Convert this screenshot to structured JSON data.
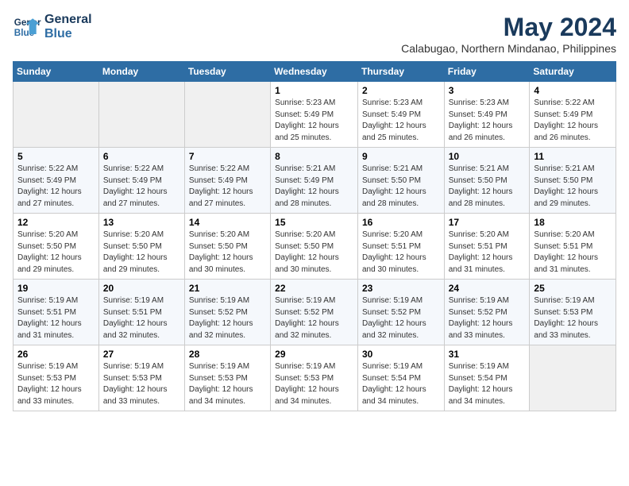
{
  "logo": {
    "line1": "General",
    "line2": "Blue"
  },
  "title": "May 2024",
  "subtitle": "Calabugao, Northern Mindanao, Philippines",
  "days_of_week": [
    "Sunday",
    "Monday",
    "Tuesday",
    "Wednesday",
    "Thursday",
    "Friday",
    "Saturday"
  ],
  "weeks": [
    [
      {
        "day": "",
        "info": ""
      },
      {
        "day": "",
        "info": ""
      },
      {
        "day": "",
        "info": ""
      },
      {
        "day": "1",
        "info": "Sunrise: 5:23 AM\nSunset: 5:49 PM\nDaylight: 12 hours\nand 25 minutes."
      },
      {
        "day": "2",
        "info": "Sunrise: 5:23 AM\nSunset: 5:49 PM\nDaylight: 12 hours\nand 25 minutes."
      },
      {
        "day": "3",
        "info": "Sunrise: 5:23 AM\nSunset: 5:49 PM\nDaylight: 12 hours\nand 26 minutes."
      },
      {
        "day": "4",
        "info": "Sunrise: 5:22 AM\nSunset: 5:49 PM\nDaylight: 12 hours\nand 26 minutes."
      }
    ],
    [
      {
        "day": "5",
        "info": "Sunrise: 5:22 AM\nSunset: 5:49 PM\nDaylight: 12 hours\nand 27 minutes."
      },
      {
        "day": "6",
        "info": "Sunrise: 5:22 AM\nSunset: 5:49 PM\nDaylight: 12 hours\nand 27 minutes."
      },
      {
        "day": "7",
        "info": "Sunrise: 5:22 AM\nSunset: 5:49 PM\nDaylight: 12 hours\nand 27 minutes."
      },
      {
        "day": "8",
        "info": "Sunrise: 5:21 AM\nSunset: 5:49 PM\nDaylight: 12 hours\nand 28 minutes."
      },
      {
        "day": "9",
        "info": "Sunrise: 5:21 AM\nSunset: 5:50 PM\nDaylight: 12 hours\nand 28 minutes."
      },
      {
        "day": "10",
        "info": "Sunrise: 5:21 AM\nSunset: 5:50 PM\nDaylight: 12 hours\nand 28 minutes."
      },
      {
        "day": "11",
        "info": "Sunrise: 5:21 AM\nSunset: 5:50 PM\nDaylight: 12 hours\nand 29 minutes."
      }
    ],
    [
      {
        "day": "12",
        "info": "Sunrise: 5:20 AM\nSunset: 5:50 PM\nDaylight: 12 hours\nand 29 minutes."
      },
      {
        "day": "13",
        "info": "Sunrise: 5:20 AM\nSunset: 5:50 PM\nDaylight: 12 hours\nand 29 minutes."
      },
      {
        "day": "14",
        "info": "Sunrise: 5:20 AM\nSunset: 5:50 PM\nDaylight: 12 hours\nand 30 minutes."
      },
      {
        "day": "15",
        "info": "Sunrise: 5:20 AM\nSunset: 5:50 PM\nDaylight: 12 hours\nand 30 minutes."
      },
      {
        "day": "16",
        "info": "Sunrise: 5:20 AM\nSunset: 5:51 PM\nDaylight: 12 hours\nand 30 minutes."
      },
      {
        "day": "17",
        "info": "Sunrise: 5:20 AM\nSunset: 5:51 PM\nDaylight: 12 hours\nand 31 minutes."
      },
      {
        "day": "18",
        "info": "Sunrise: 5:20 AM\nSunset: 5:51 PM\nDaylight: 12 hours\nand 31 minutes."
      }
    ],
    [
      {
        "day": "19",
        "info": "Sunrise: 5:19 AM\nSunset: 5:51 PM\nDaylight: 12 hours\nand 31 minutes."
      },
      {
        "day": "20",
        "info": "Sunrise: 5:19 AM\nSunset: 5:51 PM\nDaylight: 12 hours\nand 32 minutes."
      },
      {
        "day": "21",
        "info": "Sunrise: 5:19 AM\nSunset: 5:52 PM\nDaylight: 12 hours\nand 32 minutes."
      },
      {
        "day": "22",
        "info": "Sunrise: 5:19 AM\nSunset: 5:52 PM\nDaylight: 12 hours\nand 32 minutes."
      },
      {
        "day": "23",
        "info": "Sunrise: 5:19 AM\nSunset: 5:52 PM\nDaylight: 12 hours\nand 32 minutes."
      },
      {
        "day": "24",
        "info": "Sunrise: 5:19 AM\nSunset: 5:52 PM\nDaylight: 12 hours\nand 33 minutes."
      },
      {
        "day": "25",
        "info": "Sunrise: 5:19 AM\nSunset: 5:53 PM\nDaylight: 12 hours\nand 33 minutes."
      }
    ],
    [
      {
        "day": "26",
        "info": "Sunrise: 5:19 AM\nSunset: 5:53 PM\nDaylight: 12 hours\nand 33 minutes."
      },
      {
        "day": "27",
        "info": "Sunrise: 5:19 AM\nSunset: 5:53 PM\nDaylight: 12 hours\nand 33 minutes."
      },
      {
        "day": "28",
        "info": "Sunrise: 5:19 AM\nSunset: 5:53 PM\nDaylight: 12 hours\nand 34 minutes."
      },
      {
        "day": "29",
        "info": "Sunrise: 5:19 AM\nSunset: 5:53 PM\nDaylight: 12 hours\nand 34 minutes."
      },
      {
        "day": "30",
        "info": "Sunrise: 5:19 AM\nSunset: 5:54 PM\nDaylight: 12 hours\nand 34 minutes."
      },
      {
        "day": "31",
        "info": "Sunrise: 5:19 AM\nSunset: 5:54 PM\nDaylight: 12 hours\nand 34 minutes."
      },
      {
        "day": "",
        "info": ""
      }
    ]
  ]
}
